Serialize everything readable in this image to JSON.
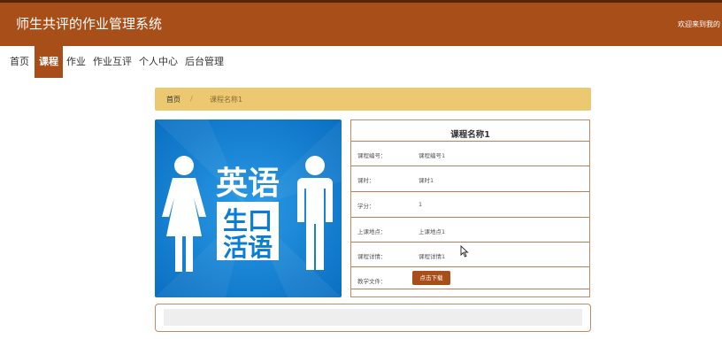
{
  "header": {
    "app_title": "师生共评的作业管理系统",
    "welcome_text": "欢迎来到我的",
    "bg_color": "#a84e19"
  },
  "nav": {
    "items": [
      {
        "label": "首页",
        "active": false
      },
      {
        "label": "课程",
        "active": true
      },
      {
        "label": "作业",
        "active": false
      },
      {
        "label": "作业互评",
        "active": false
      },
      {
        "label": "个人中心",
        "active": false
      },
      {
        "label": "后台管理",
        "active": false
      }
    ]
  },
  "breadcrumb": {
    "home": "首页",
    "separator": "/",
    "current": "课程名称1"
  },
  "course_image": {
    "big_text": "英语",
    "small_text_line1": "生口",
    "small_text_line2": "活语"
  },
  "course": {
    "title": "课程名称1",
    "rows": [
      {
        "label": "课程编号：",
        "value": "课程编号1"
      },
      {
        "label": "课时：",
        "value": "课时1"
      },
      {
        "label": "学分：",
        "value": "1"
      },
      {
        "label": "上课地点：",
        "value": "上课地点1"
      },
      {
        "label": "课程详情：",
        "value": "课程详情1"
      }
    ],
    "file_label": "教学文件：",
    "download_label": "点击下载"
  },
  "colors": {
    "accent": "#a84e19",
    "breadcrumb_bg": "#ecc970",
    "image_blue": "#0a7ed4"
  }
}
